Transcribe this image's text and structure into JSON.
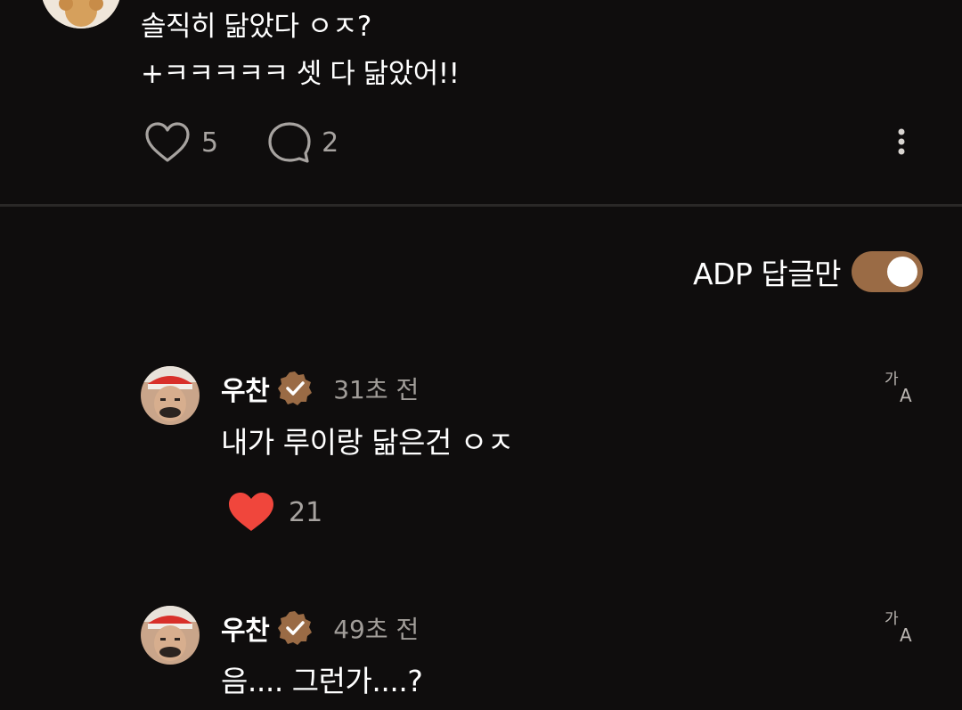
{
  "post": {
    "lines": [
      "솔직히 닮았다 ㅇㅈ?",
      "+ㅋㅋㅋㅋㅋ 셋 다 닮았어!!"
    ],
    "like_count": "5",
    "comment_count": "2",
    "icons": {
      "like": "heart-outline-icon",
      "comment": "comment-bubble-icon",
      "more": "more-vertical-icon"
    }
  },
  "filter": {
    "label": "ADP 답글만",
    "enabled": true,
    "toggle_color": "#9a6b45"
  },
  "replies": [
    {
      "name": "우찬",
      "time": "31초 전",
      "text": "내가 루이랑 닮은건 ㅇㅈ",
      "like_count": "21",
      "liked": true,
      "like_color": "#f0463c"
    },
    {
      "name": "우찬",
      "time": "49초 전",
      "text": "음.... 그런가....?"
    }
  ],
  "colors": {
    "background": "#0f0d0d",
    "muted_text": "#a7a3a0",
    "verified_badge": "#9a6b45"
  }
}
